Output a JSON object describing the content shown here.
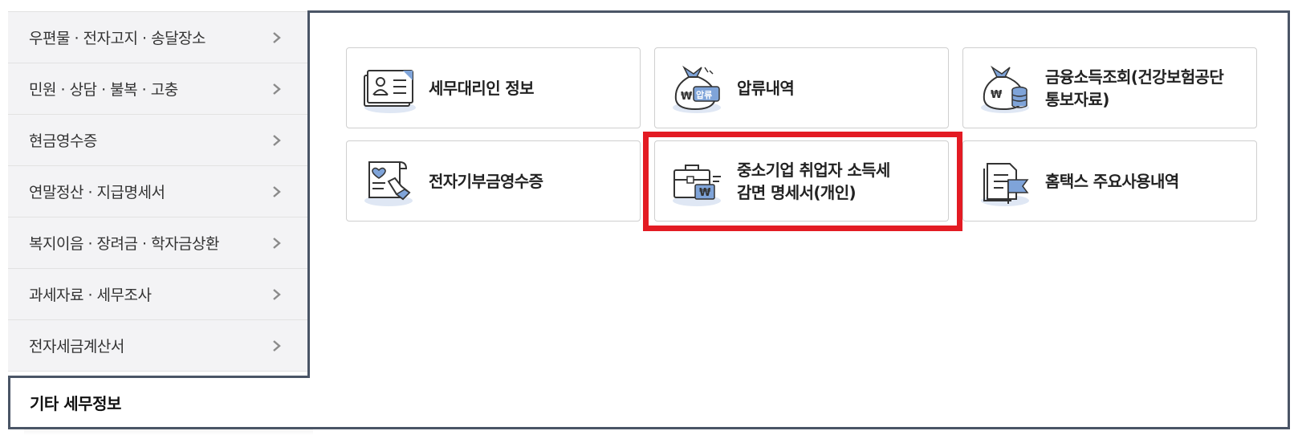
{
  "sidebar": {
    "items": [
      {
        "label": "우편물 · 전자고지 · 송달장소"
      },
      {
        "label": "민원 · 상담 · 불복 · 고충"
      },
      {
        "label": "현금영수증"
      },
      {
        "label": "연말정산 · 지급명세서"
      },
      {
        "label": "복지이음 · 장려금 · 학자금상환"
      },
      {
        "label": "과세자료 · 세무조사"
      },
      {
        "label": "전자세금계산서"
      }
    ],
    "active": {
      "label": "기타 세무정보"
    }
  },
  "cards": [
    {
      "label": "세무대리인 정보",
      "icon": "id-card-icon"
    },
    {
      "label": "압류내역",
      "icon": "money-bag-seizure-icon",
      "badge": "압류"
    },
    {
      "label": "금융소득조회(건강보험공단\n통보자료)",
      "icon": "money-bag-coins-icon"
    },
    {
      "label": "전자기부금영수증",
      "icon": "donation-receipt-icon"
    },
    {
      "label": "중소기업 취업자 소득세\n감면 명세서(개인)",
      "icon": "briefcase-won-icon"
    },
    {
      "label": "홈택스 주요사용내역",
      "icon": "document-flag-icon"
    }
  ],
  "currency_symbol": "₩",
  "colors": {
    "panel_border": "#4a5566",
    "highlight": "#e31b23",
    "icon_accent": "#7fa4d9",
    "icon_shadow": "#dfe7f4"
  }
}
